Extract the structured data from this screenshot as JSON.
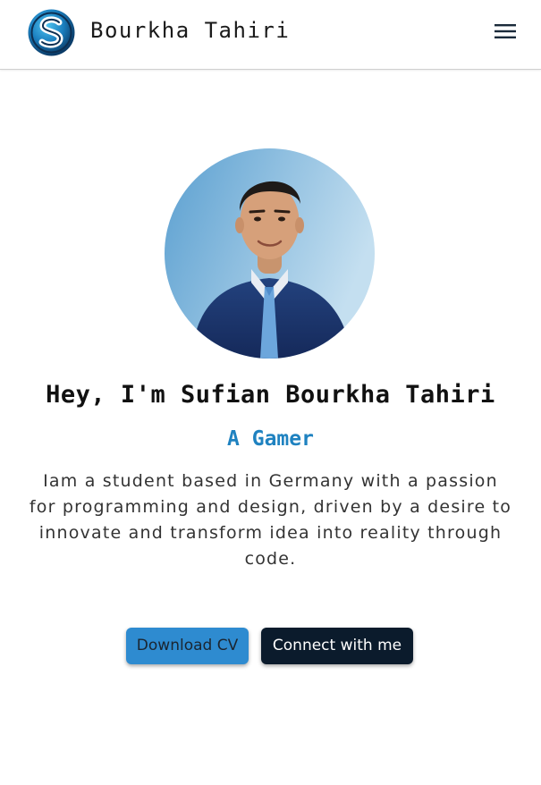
{
  "header": {
    "brand_name": "Bourkha Tahiri",
    "logo_icon": "s-logo-icon",
    "menu_icon": "hamburger-menu-icon"
  },
  "hero": {
    "title": "Hey, I'm Sufian Bourkha Tahiri",
    "role": "A Gamer",
    "description": "Iam a student based in Germany with a passion for programming and design, driven by a desire to innovate and transform idea into reality through code.",
    "avatar_icon": "profile-photo"
  },
  "buttons": {
    "download_cv": "Download CV",
    "connect": "Connect with me"
  },
  "colors": {
    "accent": "#1f82c0",
    "primary_button": "#2e8bd0",
    "dark_button": "#0b1b2c"
  }
}
